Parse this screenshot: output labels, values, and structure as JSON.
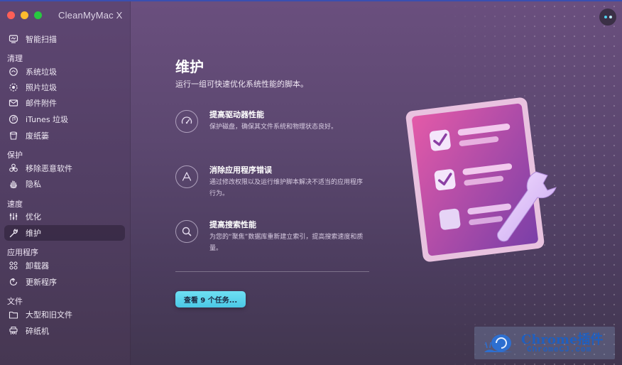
{
  "window": {
    "title": "CleanMyMac X"
  },
  "sidebar": {
    "top_item": {
      "label": "智能扫描",
      "icon": "smart-scan-icon"
    },
    "sections": [
      {
        "title": "清理",
        "items": [
          {
            "label": "系统垃圾",
            "icon": "system-junk-icon"
          },
          {
            "label": "照片垃圾",
            "icon": "photo-junk-icon"
          },
          {
            "label": "邮件附件",
            "icon": "mail-icon"
          },
          {
            "label": "iTunes 垃圾",
            "icon": "music-note-icon"
          },
          {
            "label": "废纸篓",
            "icon": "trash-icon"
          }
        ]
      },
      {
        "title": "保护",
        "items": [
          {
            "label": "移除恶意软件",
            "icon": "biohazard-icon"
          },
          {
            "label": "隐私",
            "icon": "hand-icon"
          }
        ]
      },
      {
        "title": "速度",
        "items": [
          {
            "label": "优化",
            "icon": "sliders-icon"
          },
          {
            "label": "维护",
            "icon": "wrench-icon",
            "active": true
          }
        ]
      },
      {
        "title": "应用程序",
        "items": [
          {
            "label": "卸载器",
            "icon": "uninstaller-icon"
          },
          {
            "label": "更新程序",
            "icon": "updater-icon"
          }
        ]
      },
      {
        "title": "文件",
        "items": [
          {
            "label": "大型和旧文件",
            "icon": "folder-icon"
          },
          {
            "label": "碎纸机",
            "icon": "shredder-icon"
          }
        ]
      }
    ]
  },
  "main": {
    "title": "维护",
    "subtitle": "运行一组可快速优化系统性能的脚本。",
    "features": [
      {
        "title": "提高驱动器性能",
        "desc": "保护磁盘，确保其文件系统和物理状态良好。",
        "icon": "gauge-icon"
      },
      {
        "title": "消除应用程序错误",
        "desc": "通过修改权限以及运行维护脚本解决不适当的应用程序行为。",
        "icon": "app-store-icon"
      },
      {
        "title": "提高搜索性能",
        "desc": "为您的“聚焦”数据库重新建立索引，提高搜索速度和质量。",
        "icon": "search-icon"
      }
    ],
    "view_button": "查看 9 个任务..."
  },
  "watermark": {
    "title": "Chrome插件",
    "subtitle": "ChromeCJ.com"
  },
  "colors": {
    "accent": "#4bc8e6",
    "sidebar_active": "#2f2340",
    "clipboard_pink": "#d0489b"
  }
}
